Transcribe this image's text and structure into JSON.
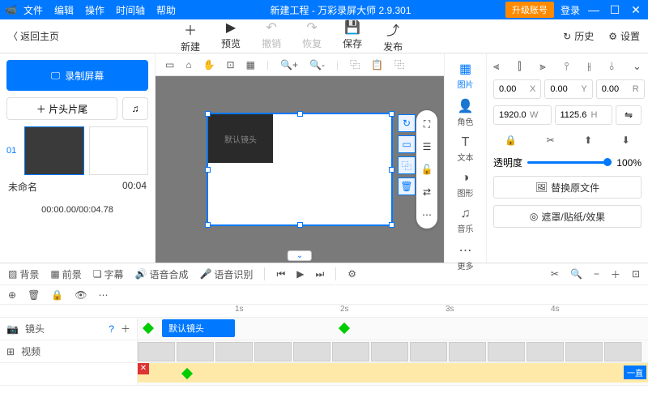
{
  "titlebar": {
    "menus": [
      "文件",
      "编辑",
      "操作",
      "时间轴",
      "帮助"
    ],
    "title": "新建工程 - 万彩录屏大师 2.9.301",
    "upgrade": "升级账号",
    "login": "登录"
  },
  "toolbar": {
    "back": "返回主页",
    "actions": [
      {
        "icon": "＋",
        "label": "新建"
      },
      {
        "icon": "▶",
        "label": "预览"
      },
      {
        "icon": "↶",
        "label": "撤销",
        "disabled": true
      },
      {
        "icon": "↷",
        "label": "恢复",
        "disabled": true
      },
      {
        "icon": "💾",
        "label": "保存"
      },
      {
        "icon": "⤴",
        "label": "发布"
      }
    ],
    "history": "历史",
    "settings": "设置"
  },
  "left": {
    "record": "录制屏幕",
    "clip": "＋ 片头片尾",
    "music_icon": "♫",
    "index": "01",
    "name": "未命名",
    "dur": "00:04",
    "time": "00:00.00/00:04.78"
  },
  "canvas": {
    "default_cam": "默认镜头"
  },
  "rightTabs": [
    {
      "icon": "▦",
      "label": "图片",
      "active": true
    },
    {
      "icon": "👤",
      "label": "角色"
    },
    {
      "icon": "T",
      "label": "文本"
    },
    {
      "icon": "◑",
      "label": "图形"
    },
    {
      "icon": "♫",
      "label": "音乐"
    },
    {
      "icon": "⋯",
      "label": "更多"
    }
  ],
  "props": {
    "x": "0.00",
    "y": "0.00",
    "r": "0.00",
    "w": "1920.0",
    "h": "1125.6",
    "opacity": "透明度",
    "opacity_val": "100%",
    "replace": "替换原文件",
    "mask": "遮罩/贴纸/效果"
  },
  "timelineTabs": [
    {
      "icon": "▨",
      "label": "背景"
    },
    {
      "icon": "▦",
      "label": "前景"
    },
    {
      "icon": "❏",
      "label": "字幕"
    },
    {
      "icon": "🔊",
      "label": "语音合成"
    },
    {
      "icon": "🎤",
      "label": "语音识别"
    }
  ],
  "ruler": [
    "1s",
    "2s",
    "3s",
    "4s"
  ],
  "tracks": {
    "cam": "镜头",
    "video": "视频",
    "default_cam": "默认镜头",
    "tag": "一直"
  }
}
